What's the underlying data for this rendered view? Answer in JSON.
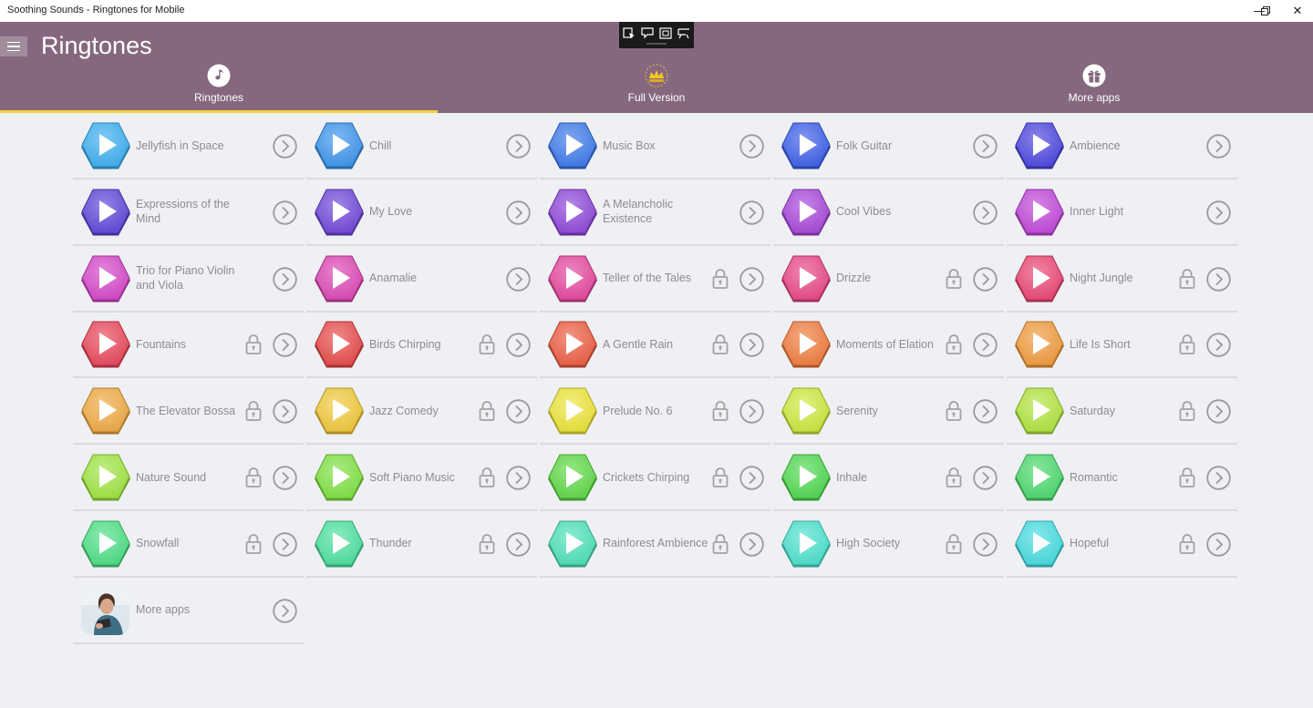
{
  "window": {
    "title": "Soothing Sounds - Ringtones for Mobile",
    "minimize_glyph": "—",
    "restore_glyph": "❐",
    "close_glyph": "✕"
  },
  "header": {
    "title": "Ringtones",
    "background": "#85687f",
    "tabs": [
      {
        "label": "Ringtones",
        "icon": "music-note-icon",
        "active": true
      },
      {
        "label": "Full Version",
        "icon": "crown-icon",
        "active": false
      },
      {
        "label": "More apps",
        "icon": "gift-icon",
        "active": false
      }
    ],
    "active_indicator_color": "#f0d23a"
  },
  "ringtones": [
    {
      "name": "Jellyfish in Space",
      "color": "#3aaef0",
      "locked": false
    },
    {
      "name": "Chill",
      "color": "#3a93ec",
      "locked": false
    },
    {
      "name": "Music Box",
      "color": "#3a78ea",
      "locked": false
    },
    {
      "name": "Folk Guitar",
      "color": "#3a5ee8",
      "locked": false
    },
    {
      "name": "Ambience",
      "color": "#4a44de",
      "locked": false
    },
    {
      "name": "Expressions of the Mind",
      "color": "#5a44d8",
      "locked": false
    },
    {
      "name": "My Love",
      "color": "#6e44d8",
      "locked": false
    },
    {
      "name": "A Melancholic Existence",
      "color": "#8c44d8",
      "locked": false
    },
    {
      "name": "Cool Vibes",
      "color": "#a644d8",
      "locked": false
    },
    {
      "name": "Inner Light",
      "color": "#c044d8",
      "locked": false
    },
    {
      "name": "Trio for Piano Violin and Viola",
      "color": "#d444c8",
      "locked": false
    },
    {
      "name": "Anamalie",
      "color": "#dc44b4",
      "locked": false
    },
    {
      "name": "Teller of the Tales",
      "color": "#e4449c",
      "locked": true
    },
    {
      "name": "Drizzle",
      "color": "#e84486",
      "locked": true
    },
    {
      "name": "Night Jungle",
      "color": "#ea4472",
      "locked": true
    },
    {
      "name": "Fountains",
      "color": "#e84458",
      "locked": true
    },
    {
      "name": "Birds Chirping",
      "color": "#e84848",
      "locked": true
    },
    {
      "name": "A Gentle Rain",
      "color": "#ec5a40",
      "locked": true
    },
    {
      "name": "Moments of Elation",
      "color": "#f07a3c",
      "locked": true
    },
    {
      "name": "Life Is Short",
      "color": "#f09a3a",
      "locked": true
    },
    {
      "name": "The Elevator Bossa",
      "color": "#f0a840",
      "locked": true
    },
    {
      "name": "Jazz Comedy",
      "color": "#f0c838",
      "locked": true
    },
    {
      "name": "Prelude No. 6",
      "color": "#ece436",
      "locked": true
    },
    {
      "name": "Serenity",
      "color": "#cce83a",
      "locked": true
    },
    {
      "name": "Saturday",
      "color": "#b0e43c",
      "locked": true
    },
    {
      "name": "Nature Sound",
      "color": "#9ee43e",
      "locked": true
    },
    {
      "name": "Soft Piano Music",
      "color": "#7ee040",
      "locked": true
    },
    {
      "name": "Crickets Chirping",
      "color": "#5ed844",
      "locked": true
    },
    {
      "name": "Inhale",
      "color": "#4ed84e",
      "locked": true
    },
    {
      "name": "Romantic",
      "color": "#4ad86a",
      "locked": true
    },
    {
      "name": "Snowfall",
      "color": "#4ade82",
      "locked": true
    },
    {
      "name": "Thunder",
      "color": "#4ae09c",
      "locked": true
    },
    {
      "name": "Rainforest Ambience",
      "color": "#4ae0b8",
      "locked": true
    },
    {
      "name": "High Society",
      "color": "#4ae0cc",
      "locked": true
    },
    {
      "name": "Hopeful",
      "color": "#44dce0",
      "locked": true
    }
  ],
  "more_apps_item": {
    "label": "More apps",
    "icon": "woman-photo"
  }
}
